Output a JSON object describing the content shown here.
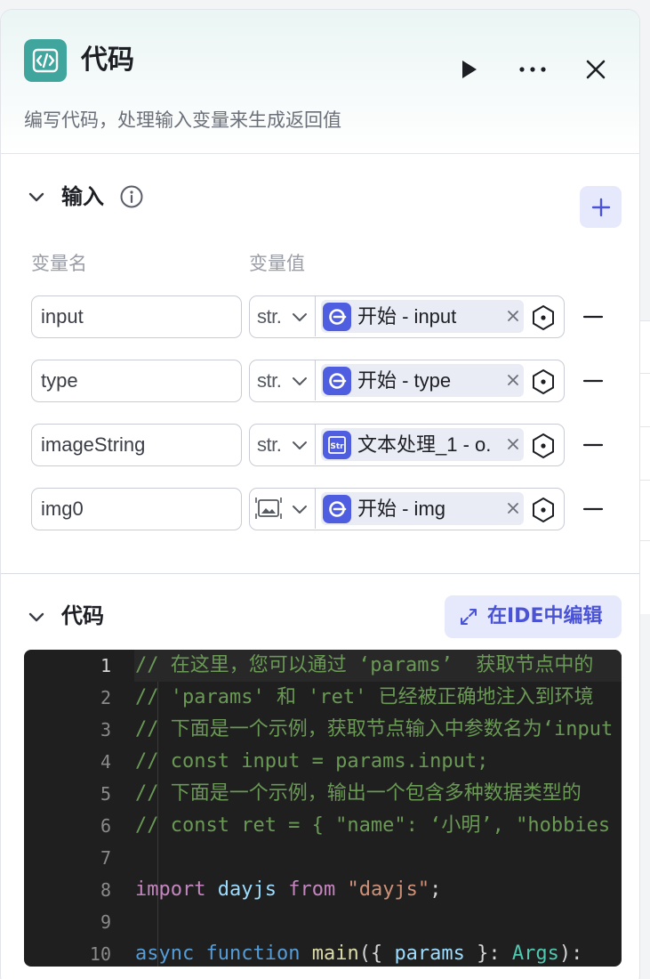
{
  "panel": {
    "title": "代码",
    "description": "编写代码，处理输入变量来生成返回值"
  },
  "input_section": {
    "title": "输入",
    "col_name": "变量名",
    "col_value": "变量值",
    "rows": [
      {
        "name": "input",
        "type": "str.",
        "type_icon": "string",
        "ref_icon": "start-node-icon",
        "ref": "开始 - input"
      },
      {
        "name": "type",
        "type": "str.",
        "type_icon": "string",
        "ref_icon": "start-node-icon",
        "ref": "开始 - type"
      },
      {
        "name": "imageString",
        "type": "str.",
        "type_icon": "string",
        "ref_icon": "text-process-node-icon",
        "ref": "文本处理_1 - o."
      },
      {
        "name": "img0",
        "type": "",
        "type_icon": "image-icon",
        "ref_icon": "start-node-icon",
        "ref": "开始 - img"
      }
    ]
  },
  "code_section": {
    "title": "代码",
    "ide_button": "在IDE中编辑",
    "lines": [
      {
        "n": "1",
        "tokens": [
          {
            "t": "// 在这里，您可以通过 ‘params’  获取节点中的",
            "c": "c-com"
          }
        ]
      },
      {
        "n": "2",
        "tokens": [
          {
            "t": "// 'params' 和 'ret' 已经被正确地注入到环境",
            "c": "c-com"
          }
        ]
      },
      {
        "n": "3",
        "tokens": [
          {
            "t": "// 下面是一个示例，获取节点输入中参数名为‘input",
            "c": "c-com"
          }
        ]
      },
      {
        "n": "4",
        "tokens": [
          {
            "t": "// const input = params.input;",
            "c": "c-com"
          }
        ]
      },
      {
        "n": "5",
        "tokens": [
          {
            "t": "// 下面是一个示例，输出一个包含多种数据类型的",
            "c": "c-com"
          }
        ]
      },
      {
        "n": "6",
        "tokens": [
          {
            "t": "// const ret = { \"name\": ‘小明’, \"hobbies",
            "c": "c-com"
          }
        ]
      },
      {
        "n": "7",
        "tokens": []
      },
      {
        "n": "8",
        "tokens": [
          {
            "t": "import",
            "c": "c-kw"
          },
          {
            "t": " ",
            "c": "c-pl"
          },
          {
            "t": "dayjs",
            "c": "c-id"
          },
          {
            "t": " ",
            "c": "c-pl"
          },
          {
            "t": "from",
            "c": "c-kw"
          },
          {
            "t": " ",
            "c": "c-pl"
          },
          {
            "t": "\"dayjs\"",
            "c": "c-str"
          },
          {
            "t": ";",
            "c": "c-pl"
          }
        ]
      },
      {
        "n": "9",
        "tokens": []
      },
      {
        "n": "10",
        "tokens": [
          {
            "t": "async",
            "c": "c-kw2"
          },
          {
            "t": " ",
            "c": "c-pl"
          },
          {
            "t": "function",
            "c": "c-kw2"
          },
          {
            "t": " ",
            "c": "c-pl"
          },
          {
            "t": "main",
            "c": "c-fn"
          },
          {
            "t": "({ ",
            "c": "c-pl"
          },
          {
            "t": "params",
            "c": "c-id"
          },
          {
            "t": " }: ",
            "c": "c-pl"
          },
          {
            "t": "Args",
            "c": "c-type"
          },
          {
            "t": "):",
            "c": "c-pl"
          }
        ]
      }
    ]
  },
  "colors": {
    "accent": "#4a53d6",
    "node_icon": "#3fa59d",
    "ref_icon": "#4f5ee0",
    "editor_bg": "#1f1f1f"
  }
}
